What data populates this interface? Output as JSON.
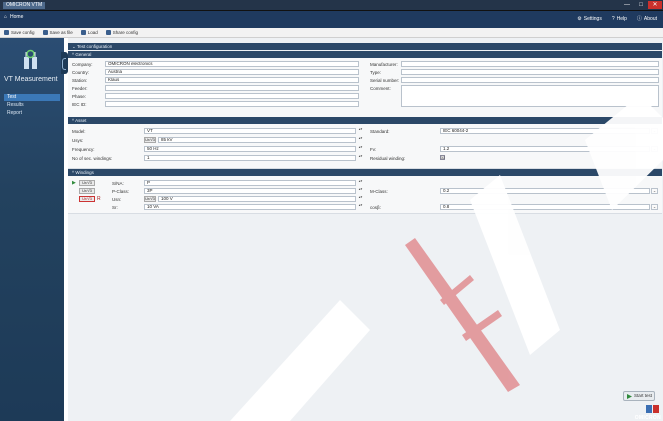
{
  "window": {
    "app_title": "OMICRON VTM",
    "close": "✕",
    "maximize": "□",
    "minimize": "—"
  },
  "menubar": {
    "home": "Home",
    "settings": "Settings",
    "help": "Help",
    "about": "About"
  },
  "toolbar": {
    "save": "Save config",
    "save_as": "Save as file",
    "load": "Load",
    "share": "Share config"
  },
  "sidebar": {
    "title": "VT Measurement",
    "items": [
      {
        "label": "Test",
        "active": true
      },
      {
        "label": "Results",
        "active": false
      },
      {
        "label": "Report",
        "active": false
      }
    ]
  },
  "main": {
    "config_title": "Test configuration",
    "general": {
      "title": "General",
      "company_label": "Company:",
      "company_value": "OMICRON electronics",
      "country_label": "Country:",
      "country_value": "Austria",
      "station_label": "Station:",
      "station_value": "Klaus",
      "feeder_label": "Feeder:",
      "feeder_value": "",
      "phase_label": "Phase:",
      "phase_value": "",
      "iec_label": "IEC ID:",
      "iec_value": "",
      "manufacturer_label": "Manufacturer:",
      "manufacturer_value": "",
      "type_label": "Type:",
      "type_value": "",
      "serial_label": "Serial number:",
      "serial_value": "",
      "comment_label": "Comment:",
      "comment_value": ""
    },
    "asset": {
      "title": "Asset",
      "model_label": "Model:",
      "model_value": "VT",
      "usys_label": "Usys:",
      "usys_btn": "Ur/√3",
      "usys_value": "85 kV",
      "freq_label": "Frequency:",
      "freq_value": "50 Hz",
      "nsec_label": "No of sec. windings:",
      "nsec_value": "1",
      "standard_label": "Standard:",
      "standard_value": "IEC 60044-2",
      "fv_label": "Fv:",
      "fv_value": "1.2",
      "residual_label": "Residual winding:",
      "residual_checked": "☒"
    },
    "windings": {
      "title": "Windings",
      "row1_btn": "Ur/√3",
      "row2_btn": "Ur/√3",
      "row3_btn": "Ur/√3",
      "sna_label": "S/NA:",
      "sna_value": "P",
      "pclass_label": "P-Class:",
      "pclass_value": "3P",
      "usn_label": "Usn:",
      "usn_btn": "Ur/√3",
      "usn_value": "100 V",
      "sr_label": "Sr:",
      "sr_value": "10 VA",
      "mclass_label": "M-Class:",
      "mclass_value": "0.2",
      "cosb_label": "cosβ:",
      "cosb_value": "0.8"
    },
    "start_button": "Start test",
    "brand": "OMICRON"
  },
  "colors": {
    "accent": "#1f3a5f",
    "active_nav": "#3b78b7",
    "watermark": "#d4363a"
  }
}
